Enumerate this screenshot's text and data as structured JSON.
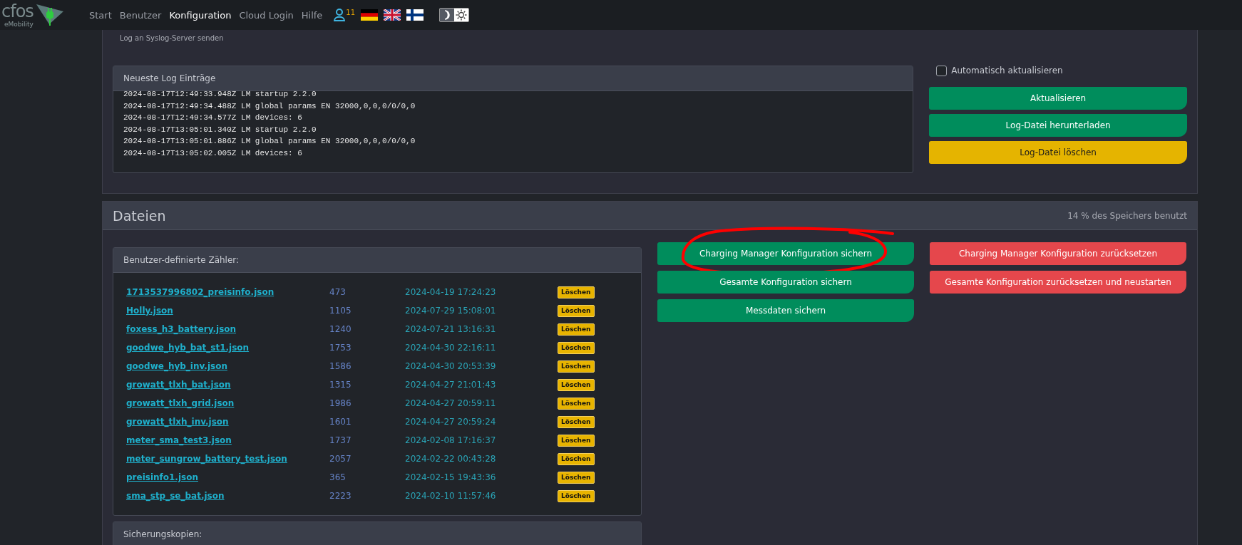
{
  "nav": {
    "logo": "cfos",
    "logo_sub": "eMobility",
    "links": [
      {
        "label": "Start",
        "selected": false
      },
      {
        "label": "Benutzer",
        "selected": false
      },
      {
        "label": "Konfiguration",
        "selected": true
      },
      {
        "label": "Cloud Login",
        "selected": false
      },
      {
        "label": "Hilfe",
        "selected": false
      }
    ],
    "user_count": "11",
    "languages": [
      {
        "kind": "de"
      },
      {
        "kind": "gb"
      },
      {
        "kind": "fi"
      }
    ],
    "theme": [
      {
        "kind": "moon",
        "selected": true
      },
      {
        "kind": "sun",
        "selected": false
      }
    ]
  },
  "log_section": {
    "syslog_label": "Log an Syslog-Server senden",
    "log_card": {
      "title": "Neueste Log Einträge",
      "lines": [
        "2024-08-17T12:49:33.948Z LM startup 2.2.0",
        "2024-08-17T12:49:34.488Z LM global params EN 32000,0,0,0/0/0,0",
        "2024-08-17T12:49:34.577Z LM devices: 6",
        "2024-08-17T13:05:01.340Z LM startup 2.2.0",
        "2024-08-17T13:05:01.886Z LM global params EN 32000,0,0,0/0/0,0",
        "2024-08-17T13:05:02.005Z LM devices: 6"
      ]
    },
    "auto_refresh": {
      "label": "Automatisch aktualisieren",
      "checked": false
    },
    "buttons": [
      {
        "label": "Aktualisieren",
        "kind": "success"
      },
      {
        "label": "Log-Datei herunterladen",
        "kind": "success"
      },
      {
        "label": "Log-Datei löschen",
        "kind": "warning"
      }
    ]
  },
  "files": {
    "title": "Dateien",
    "usage": "14 % des Speichers benutzt",
    "counters": {
      "title": "Benutzer-definierte Zähler:",
      "rows": [
        {
          "name": "1713537996802_preisinfo.json",
          "size": "473",
          "date": "2024-04-19 17:24:23",
          "action": "Löschen"
        },
        {
          "name": "Holly.json",
          "size": "1105",
          "date": "2024-07-29 15:08:01",
          "action": "Löschen"
        },
        {
          "name": "foxess_h3_battery.json",
          "size": "1240",
          "date": "2024-07-21 13:16:31",
          "action": "Löschen"
        },
        {
          "name": "goodwe_hyb_bat_st1.json",
          "size": "1753",
          "date": "2024-04-30 22:16:11",
          "action": "Löschen"
        },
        {
          "name": "goodwe_hyb_inv.json",
          "size": "1586",
          "date": "2024-04-30 20:53:39",
          "action": "Löschen"
        },
        {
          "name": "growatt_tlxh_bat.json",
          "size": "1315",
          "date": "2024-04-27 21:01:43",
          "action": "Löschen"
        },
        {
          "name": "growatt_tlxh_grid.json",
          "size": "1986",
          "date": "2024-04-27 20:59:11",
          "action": "Löschen"
        },
        {
          "name": "growatt_tlxh_inv.json",
          "size": "1601",
          "date": "2024-04-27 20:59:24",
          "action": "Löschen"
        },
        {
          "name": "meter_sma_test3.json",
          "size": "1737",
          "date": "2024-02-08 17:16:37",
          "action": "Löschen"
        },
        {
          "name": "meter_sungrow_battery_test.json",
          "size": "2057",
          "date": "2024-02-22 00:43:28",
          "action": "Löschen"
        },
        {
          "name": "preisinfo1.json",
          "size": "365",
          "date": "2024-02-15 19:43:36",
          "action": "Löschen"
        },
        {
          "name": "sma_stp_se_bat.json",
          "size": "2223",
          "date": "2024-02-10 11:57:46",
          "action": "Löschen"
        }
      ]
    },
    "save_buttons": [
      {
        "label": "Charging Manager Konfiguration sichern",
        "kind": "success",
        "circled": true
      },
      {
        "label": "Gesamte Konfiguration sichern",
        "kind": "success",
        "circled": false
      },
      {
        "label": "Messdaten sichern",
        "kind": "success",
        "circled": false
      }
    ],
    "reset_buttons": [
      {
        "label": "Charging Manager Konfiguration zurücksetzen",
        "kind": "danger"
      },
      {
        "label": "Gesamte Konfiguration zurücksetzen und neustarten",
        "kind": "danger"
      }
    ],
    "backups": {
      "title": "Sicherungskopien:"
    }
  }
}
